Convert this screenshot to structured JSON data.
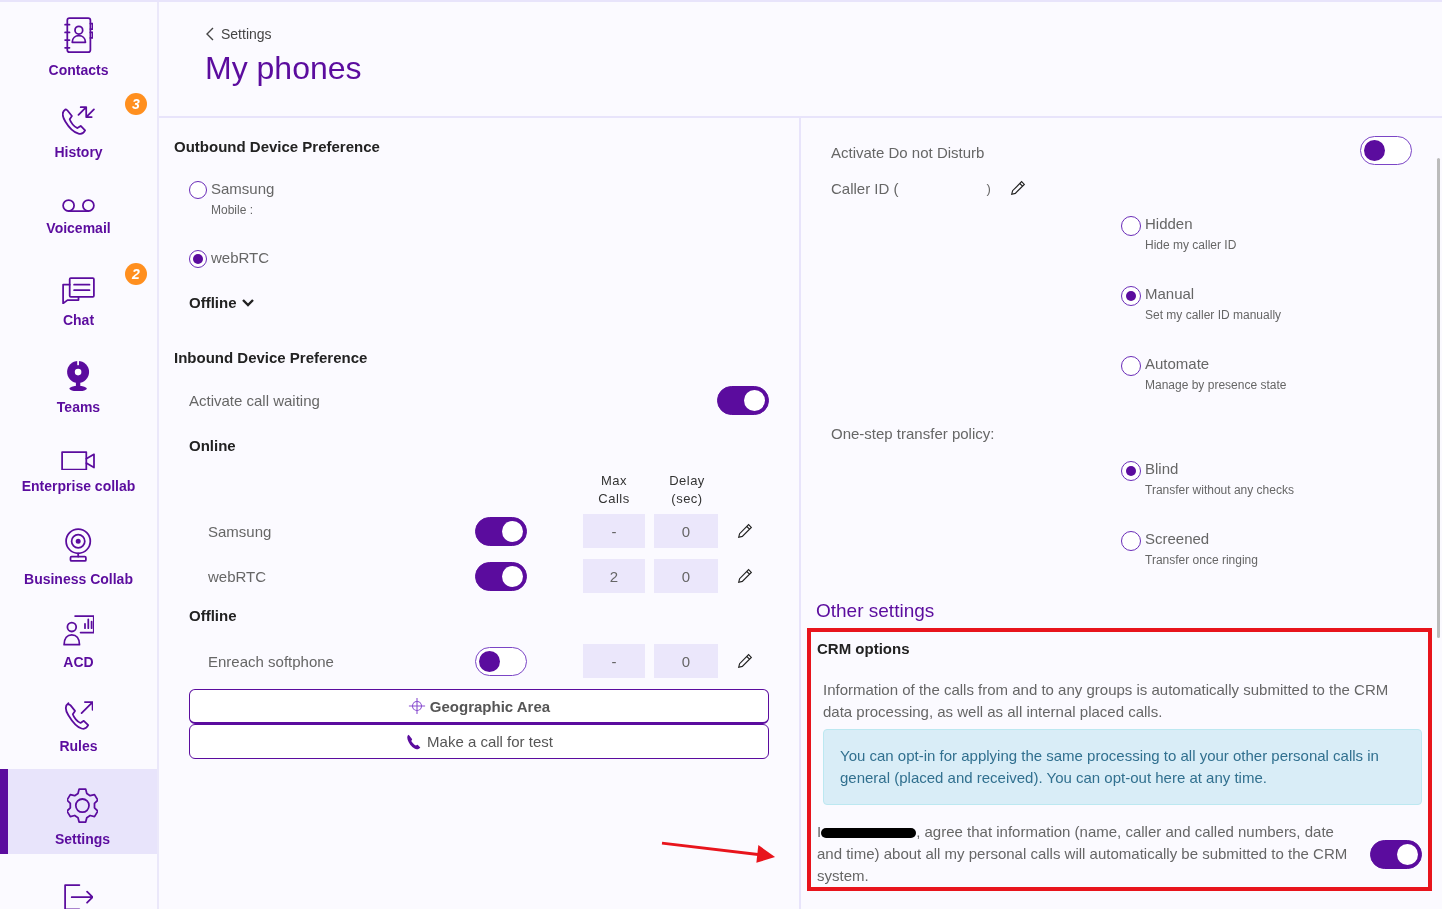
{
  "sidebar": {
    "items": [
      {
        "label": "Contacts",
        "selected": false
      },
      {
        "label": "History",
        "badge": "3",
        "selected": false
      },
      {
        "label": "Voicemail",
        "selected": false
      },
      {
        "label": "Chat",
        "badge": "2",
        "selected": false
      },
      {
        "label": "Teams",
        "selected": false
      },
      {
        "label": "Enterprise collab",
        "selected": false
      },
      {
        "label": "Business Collab",
        "selected": false
      },
      {
        "label": "ACD",
        "selected": false
      },
      {
        "label": "Rules",
        "selected": false
      },
      {
        "label": "Settings",
        "selected": true
      },
      {
        "selected": false
      }
    ]
  },
  "header": {
    "back": "Settings",
    "title": "My phones"
  },
  "outbound": {
    "title": "Outbound Device Preference",
    "options": [
      {
        "label": "Samsung",
        "sub": "Mobile :",
        "selected": false
      },
      {
        "label": "webRTC",
        "selected": true
      }
    ],
    "offline_toggle": "Offline"
  },
  "inbound": {
    "title": "Inbound Device Preference",
    "call_waiting": {
      "label": "Activate call waiting",
      "on": true
    },
    "online_title": "Online",
    "col_max": "Max\nCalls",
    "col_delay": "Delay\n(sec)",
    "online": [
      {
        "name": "Samsung",
        "on": true,
        "max_calls": "-",
        "delay": "0"
      },
      {
        "name": "webRTC",
        "on": true,
        "max_calls": "2",
        "delay": "0"
      }
    ],
    "offline_title": "Offline",
    "offline": [
      {
        "name": "Enreach softphone",
        "on": false,
        "max_calls": "-",
        "delay": "0"
      }
    ]
  },
  "buttons": {
    "geo": "Geographic Area",
    "test": "Make a call for test"
  },
  "right": {
    "dnd": {
      "label": "Activate Do not Disturb",
      "on": false
    },
    "caller_id": {
      "open": "Caller ID (",
      "close": ")"
    },
    "caller_options": [
      {
        "label": "Hidden",
        "sub": "Hide my caller ID",
        "selected": false
      },
      {
        "label": "Manual",
        "sub": "Set my caller ID manually",
        "selected": true
      },
      {
        "label": "Automate",
        "sub": "Manage by presence state",
        "selected": false
      }
    ],
    "transfer_label": "One-step transfer policy:",
    "transfer_options": [
      {
        "label": "Blind",
        "sub": "Transfer without any checks",
        "selected": true
      },
      {
        "label": "Screened",
        "sub": "Transfer once ringing",
        "selected": false
      }
    ],
    "other_title": "Other settings",
    "crm": {
      "title": "CRM options",
      "info": "Information of the calls from and to any groups is automatically submitted to the CRM data processing, as well as all internal placed calls.",
      "notice": "You can opt-in for applying the same processing to all your other personal calls in general (placed and received). You can opt-out here at any time.",
      "consent_prefix": "I",
      "consent": ", agree that information (name, caller and called numbers, date and time) about all my personal calls will automatically be submitted to the CRM system.",
      "consent_on": true
    }
  }
}
